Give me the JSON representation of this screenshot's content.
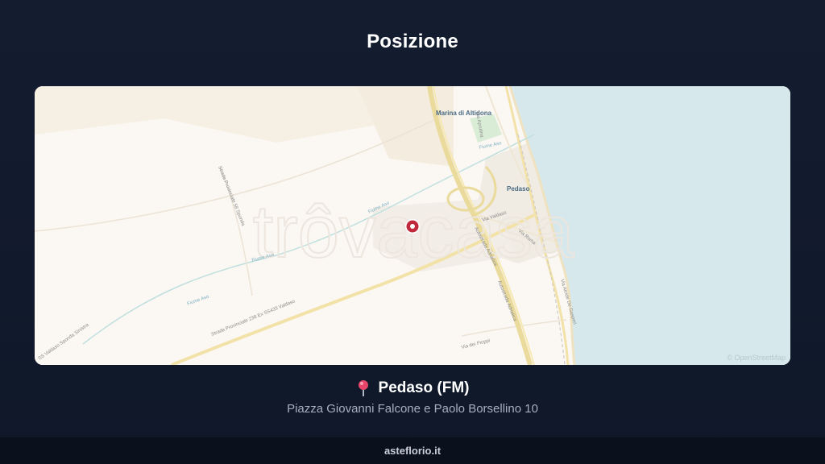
{
  "header": {
    "title": "Posizione"
  },
  "map": {
    "watermark": "trôvacasa",
    "attribution": "© OpenStreetMap",
    "labels": {
      "marina": "Marina di Altidona",
      "pedaso": "Pedaso",
      "via_aprutina": "Via Aprutina",
      "fiume_aso_1": "Fiume Aso",
      "fiume_aso_2": "Fiume Aso",
      "fiume_aso_3": "Fiume Aso",
      "fiume_aso_4": "Fiume Aso",
      "via_valdaso": "Via Valdaso",
      "strada_sp": "Strada Provinciale 238 Ex SS433 Valdaso",
      "autostrada_1": "Autostrada Adriatica",
      "autostrada_2": "Autostrada Adriatica",
      "via_alcide": "Via Alcide De Gasperi",
      "via_roma": "Via Roma",
      "via_pioppi": "Via dei Pioppi",
      "sp_valdaso_sinistra": "SS Valdaso Sponda Sinistra",
      "strada_prov_58": "Strada Provinciale 58 Sponda"
    },
    "colors": {
      "land": "#fbf7f2",
      "sea": "#d6e8ec",
      "marker": "#c0283c"
    }
  },
  "location": {
    "pin_icon": "pin-icon",
    "name": "Pedaso (FM)",
    "address": "Piazza Giovanni Falcone e Paolo Borsellino 10"
  },
  "footer": {
    "site": "asteflorio.it"
  }
}
